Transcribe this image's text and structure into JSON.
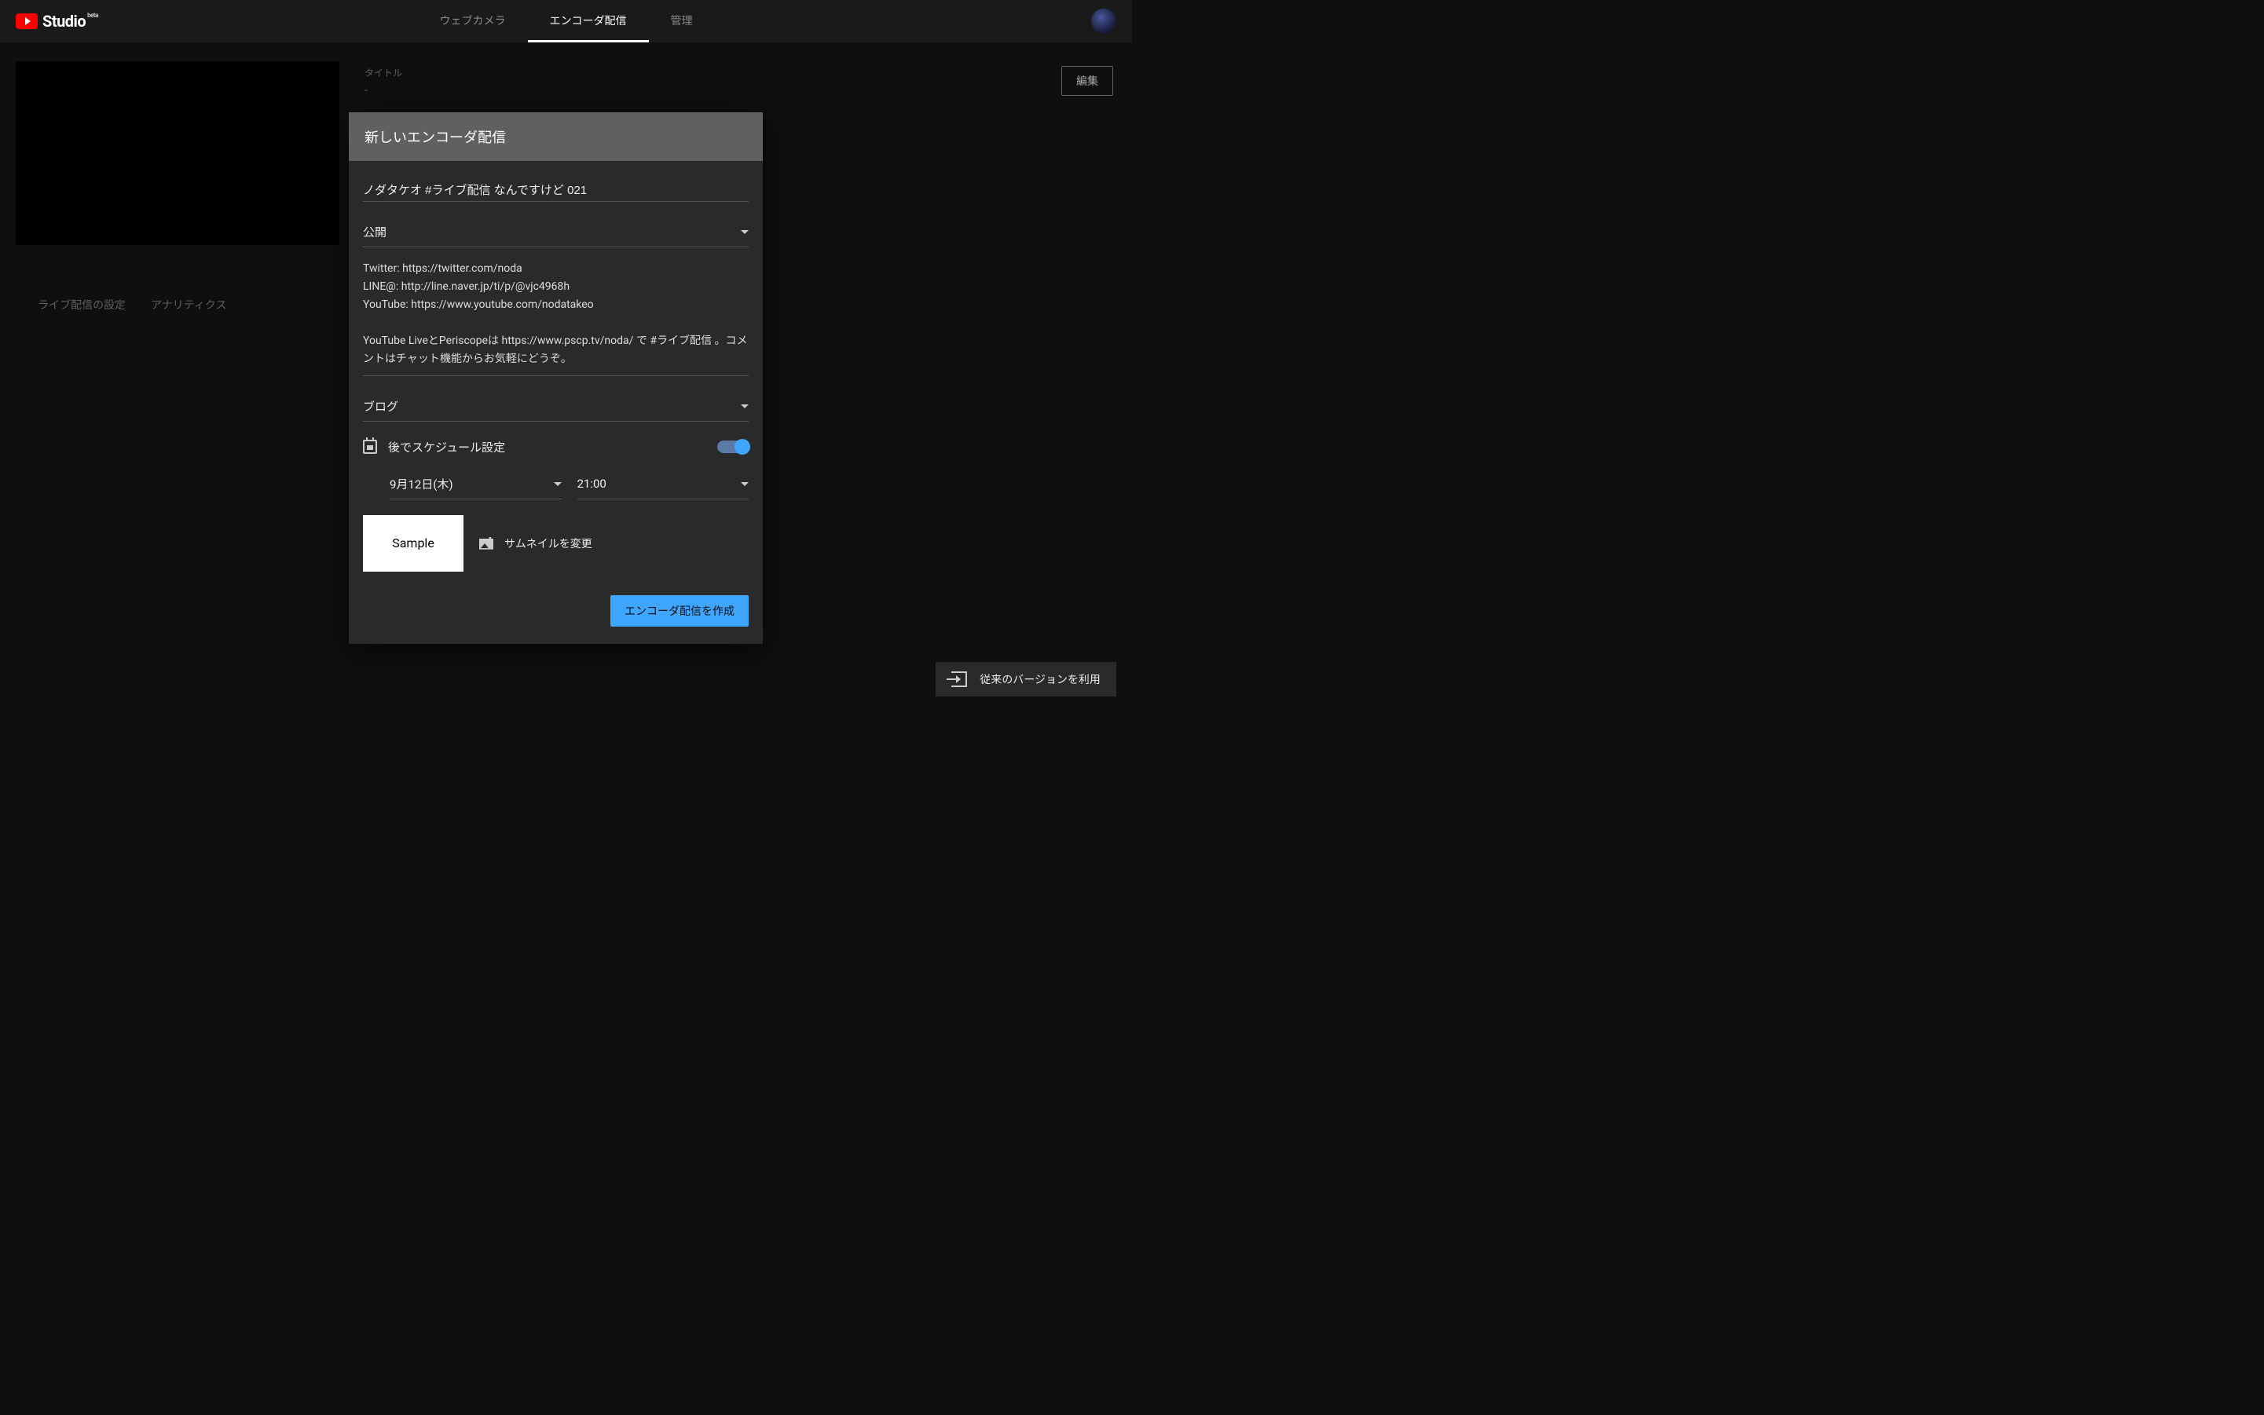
{
  "header": {
    "logo_text": "Studio",
    "beta": "beta",
    "tabs": [
      {
        "label": "ウェブカメラ",
        "active": false
      },
      {
        "label": "エンコーダ配信",
        "active": true
      },
      {
        "label": "管理",
        "active": false
      }
    ]
  },
  "left_panel": {
    "settings_tabs": [
      "ライブ配信の設定",
      "アナリティクス"
    ]
  },
  "right_panel": {
    "title_label": "タイトル",
    "title_value": "-",
    "edit_button": "編集"
  },
  "modal": {
    "heading": "新しいエンコーダ配信",
    "title_input": "ノダタケオ #ライブ配信 なんですけど 021",
    "visibility": "公開",
    "description": "Twitter: https://twitter.com/noda\nLINE@: http://line.naver.jp/ti/p/@vjc4968h\nYouTube: https://www.youtube.com/nodatakeo\n\nYouTube LiveとPeriscopeは https://www.pscp.tv/noda/ で #ライブ配信 。コメントはチャット機能からお気軽にどうぞ。",
    "category": "ブログ",
    "schedule_label": "後でスケジュール設定",
    "schedule_on": true,
    "date": "9月12日(木)",
    "time": "21:00",
    "thumbnail_text": "Sample",
    "change_thumbnail": "サムネイルを変更",
    "create_button": "エンコーダ配信を作成"
  },
  "bottom": {
    "legacy_button": "従来のバージョンを利用"
  }
}
